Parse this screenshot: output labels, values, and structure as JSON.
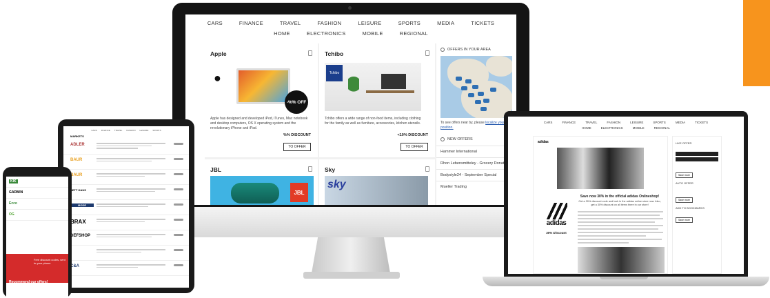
{
  "desktop": {
    "nav_row1": [
      "CARS",
      "FINANCE",
      "TRAVEL",
      "FASHION",
      "LEISURE",
      "SPORTS",
      "MEDIA",
      "TICKETS"
    ],
    "nav_row2": [
      "HOME",
      "ELECTRONICS",
      "MOBILE",
      "REGIONAL"
    ],
    "cards": [
      {
        "brand": "Apple",
        "badge": "-%% OFF",
        "description": "Apple has designed and developed iPod, iTunes, Mac notebook and desktop computers, OS X operating system and the revolutionary iPhone and iPad.",
        "discount": "%% DISCOUNT",
        "button": "TO OFFER"
      },
      {
        "brand": "Tchibo",
        "logo_text": "Tchibo",
        "description": "Tchibo offers a wide range of non-food items, including clothing for the family as well as furniture, accessories, kitchen utensils.",
        "discount": "<10% DISCOUNT",
        "button": "TO OFFER"
      },
      {
        "brand": "JBL",
        "logo_text": "JBL"
      },
      {
        "brand": "Sky",
        "logo_text": "sky"
      }
    ],
    "sidebar": {
      "offers_area_title": "OFFERS IN YOUR AREA",
      "area_note": "To see offers near by, please",
      "area_link": "localize your position.",
      "new_offers_title": "NEW OFFERS",
      "new_offers": [
        "Hammer International",
        "Rhon Lebensmitteley - Grocery Donations",
        "Bodystyle24 - September Special",
        "Mueller Trading"
      ]
    }
  },
  "laptop": {
    "nav_row1": [
      "CARS",
      "FINANCE",
      "TRAVEL",
      "FASHION",
      "LEISURE",
      "SPORTS",
      "MEDIA",
      "TICKETS"
    ],
    "nav_row2": [
      "HOME",
      "ELECTRONICS",
      "MOBILE",
      "REGIONAL"
    ],
    "brand": "adidas",
    "logo_word": "adidas",
    "discount": "30% Discount",
    "promo_title": "Save now 30% in the official adidas Onlineshop!",
    "promo_sub": "Get a 30% discount code and look in the adidas online store now. Also, get a 30% discount on all items there in our store!",
    "side_title": "LIKE OFFER",
    "side_auto": "AUTO OFFER",
    "side_bookmark": "ADD TO BOOKMARKS",
    "side_button": "Save more"
  },
  "tablet": {
    "section": "MARKETS",
    "brands": [
      "ADLER",
      "BAUR",
      "BAUR",
      "BETT HAUS",
      "MODE",
      "BRAX",
      "DEFSHOP",
      "",
      "C&A"
    ]
  },
  "phone": {
    "brands": [
      "KIK",
      "GARMIN",
      "Ecco",
      "OG"
    ],
    "banner_text": "Free discount codes, sent to your phone",
    "recommend": "Recommend our offers!"
  }
}
